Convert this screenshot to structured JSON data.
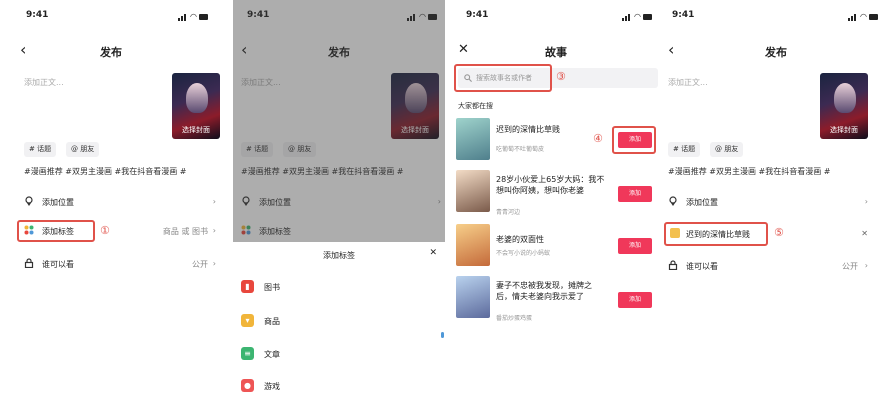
{
  "status": {
    "time": "9:41"
  },
  "p1": {
    "title": "发布",
    "placeholder": "添加正文...",
    "cover_label": "选择封面",
    "chip_topic": "# 话题",
    "chip_friend": "@ 朋友",
    "tags": "#漫画推荐  #双男主漫画  #我在抖音看漫画  #",
    "location": "添加位置",
    "label": "添加标签",
    "label_right": "商品 或 图书",
    "visibility": "谁可以看",
    "visibility_value": "公开",
    "badge": "①"
  },
  "p2": {
    "title": "发布",
    "placeholder": "添加正文...",
    "cover_label": "选择封面",
    "chip_topic": "# 话题",
    "chip_friend": "@ 朋友",
    "tags": "#漫画推荐  #双男主漫画  #我在抖音看漫画  #",
    "location": "添加位置",
    "label": "添加标签",
    "sheet_title": "添加标签",
    "options": [
      {
        "label": "图书",
        "icon": "book-icon",
        "color": "#e8473d"
      },
      {
        "label": "商品",
        "icon": "cart-icon",
        "color": "#f1b53a"
      },
      {
        "label": "文章",
        "icon": "article-icon",
        "color": "#3cb571"
      },
      {
        "label": "游戏",
        "icon": "game-icon",
        "color": "#ee5555"
      }
    ]
  },
  "p3": {
    "title": "故事",
    "search_placeholder": "搜索故事名或作者",
    "badge_search": "③",
    "section": "大家都在搜",
    "badge_add": "④",
    "add": "添加",
    "stories": [
      {
        "title": "迟到的深情比草贱",
        "author": "吃葡萄不吐葡萄皮"
      },
      {
        "title": "28岁小伙爱上65岁大妈：我不想叫你阿姨，想叫你老婆",
        "author": "青青河边"
      },
      {
        "title": "老婆的双面性",
        "author": "不会写小说的小蚂蚁"
      },
      {
        "title": "妻子不忠被我发现，摊牌之后，情夫老婆向我示爱了",
        "author": "番茄炒蛋鸡蛋"
      }
    ]
  },
  "p4": {
    "title": "发布",
    "placeholder": "添加正文...",
    "cover_label": "选择封面",
    "chip_topic": "# 话题",
    "chip_friend": "@ 朋友",
    "tags": "#漫画推荐  #双男主漫画  #我在抖音看漫画  #",
    "location": "添加位置",
    "story_tag": "迟到的深情比草贱",
    "badge": "⑤",
    "visibility": "谁可以看",
    "visibility_value": "公开"
  }
}
